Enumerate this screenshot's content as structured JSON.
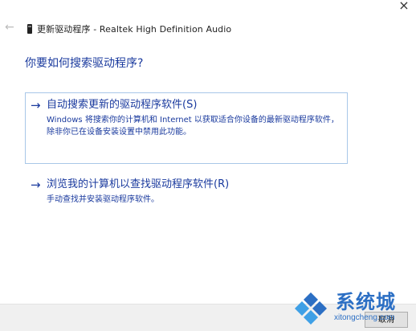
{
  "window": {
    "title": "更新驱动程序 - Realtek High Definition Audio",
    "close_glyph": "×",
    "back_glyph": "←"
  },
  "heading": "你要如何搜索驱动程序?",
  "options": [
    {
      "title": "自动搜索更新的驱动程序软件(S)",
      "description": "Windows 将搜索你的计算机和 Internet 以获取适合你设备的最新驱动程序软件，除非你已在设备安装设置中禁用此功能。",
      "arrow": "→"
    },
    {
      "title": "浏览我的计算机以查找驱动程序软件(R)",
      "description": "手动查找并安装驱动程序软件。",
      "arrow": "→"
    }
  ],
  "footer": {
    "cancel_label": "取消"
  },
  "watermark": {
    "brand": "系统城",
    "url": "xitongcheng.com"
  },
  "colors": {
    "link_blue": "#1a3a9e",
    "selection_border": "#a8c7e8",
    "watermark_blue": "#2c6fc4"
  }
}
